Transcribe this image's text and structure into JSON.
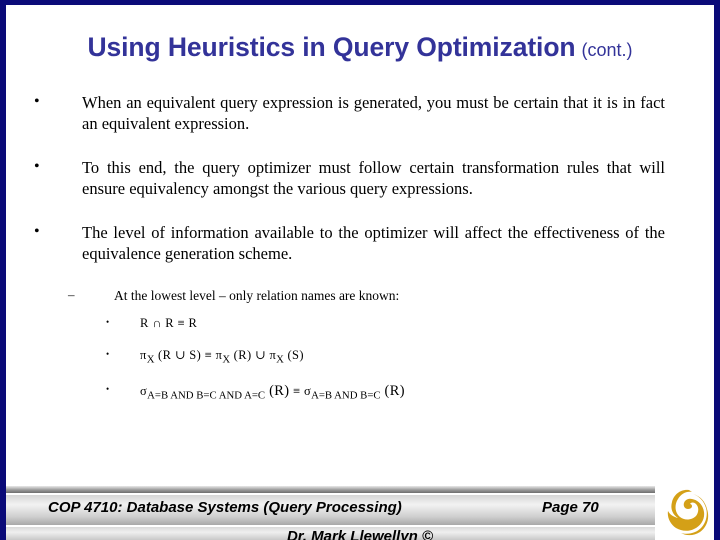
{
  "slide": {
    "title_main": "Using Heuristics in Query Optimization",
    "title_suffix": "(cont.)",
    "title_color": "#333399",
    "frame_color": "#0a0a78",
    "background": "#ffffff"
  },
  "bullets": [
    {
      "level": 1,
      "marker": "•",
      "text": "When an equivalent query expression is generated, you must be certain that it is in fact an equivalent expression."
    },
    {
      "level": 1,
      "marker": "•",
      "text": "To this end, the query optimizer must follow certain transformation rules that will ensure equivalency amongst the various query expressions."
    },
    {
      "level": 1,
      "marker": "•",
      "text": "The level of information available to the optimizer will affect the effectiveness of the equivalence generation scheme."
    },
    {
      "level": 2,
      "marker": "–",
      "text": "At the lowest level – only relation names are known:"
    }
  ],
  "formulas": [
    {
      "marker": "•",
      "plain": "R ∩ R ≡ R",
      "parts": [
        {
          "t": "R ∩ R ≡ R",
          "k": "base"
        }
      ]
    },
    {
      "marker": "•",
      "plain": "πX (R ∪ S) ≡ πX (R) ∪ πX (S)",
      "parts": [
        {
          "t": "π",
          "k": "base"
        },
        {
          "t": "X",
          "k": "sub"
        },
        {
          "t": " (R ∪ S) ≡ ",
          "k": "base"
        },
        {
          "t": "π",
          "k": "base"
        },
        {
          "t": "X",
          "k": "sub"
        },
        {
          "t": " (R)  ∪  ",
          "k": "base"
        },
        {
          "t": "π",
          "k": "base"
        },
        {
          "t": "X",
          "k": "sub"
        },
        {
          "t": " (S)",
          "k": "base"
        }
      ]
    },
    {
      "marker": "•",
      "plain": "σA=B AND B=C AND A=C (R) ≡ σA=B AND B=C (R)",
      "parts": [
        {
          "t": "σ",
          "k": "base"
        },
        {
          "t": "A=B AND B=C AND A=C",
          "k": "sub"
        },
        {
          "t": " (R)",
          "k": "arg"
        },
        {
          "t": " ≡ ",
          "k": "base"
        },
        {
          "t": "σ",
          "k": "base"
        },
        {
          "t": "A=B AND B=C",
          "k": "sub"
        },
        {
          "t": " (R)",
          "k": "arg"
        }
      ]
    }
  ],
  "footer": {
    "course": "COP 4710: Database Systems (Query Processing)",
    "page": "Page 70",
    "author": "Dr. Mark Llewellyn ©",
    "logo_name": "ucf-pegasus-logo",
    "logo_color": "#d4a017"
  }
}
